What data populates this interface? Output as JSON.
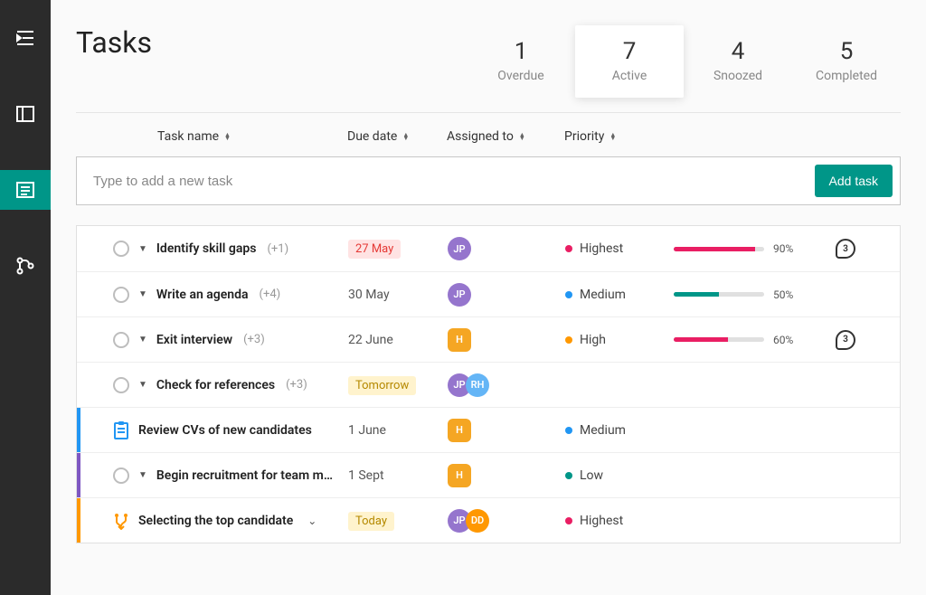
{
  "nav": [
    {
      "name": "indent-icon",
      "active": false
    },
    {
      "name": "panel-icon",
      "active": false
    },
    {
      "name": "list-icon",
      "active": true
    },
    {
      "name": "workflow-icon",
      "active": false
    }
  ],
  "page": {
    "title": "Tasks"
  },
  "summary": [
    {
      "count": "1",
      "label": "Overdue",
      "active": false
    },
    {
      "count": "7",
      "label": "Active",
      "active": true
    },
    {
      "count": "4",
      "label": "Snoozed",
      "active": false
    },
    {
      "count": "5",
      "label": "Completed",
      "active": false
    }
  ],
  "columns": {
    "task": "Task name",
    "due": "Due date",
    "assigned": "Assigned to",
    "priority": "Priority"
  },
  "input": {
    "placeholder": "Type to add a new task",
    "button": "Add task"
  },
  "tasks": [
    {
      "icon": "circle",
      "caret": true,
      "name": "Identify skill gaps",
      "sub": "(+1)",
      "due": "27 May",
      "dueStyle": "red",
      "assignees": [
        {
          "txt": "JP",
          "cls": "av-purple"
        }
      ],
      "priority": "Highest",
      "priorityClass": "dot-highest",
      "progress": 90,
      "progressClass": "pfill-pink",
      "progressText": "90%",
      "comments": "3",
      "bar": ""
    },
    {
      "icon": "circle",
      "caret": true,
      "name": "Write an agenda",
      "sub": "(+4)",
      "due": "30 May",
      "dueStyle": "plain",
      "assignees": [
        {
          "txt": "JP",
          "cls": "av-purple"
        }
      ],
      "priority": "Medium",
      "priorityClass": "dot-medium",
      "progress": 50,
      "progressClass": "pfill-teal",
      "progressText": "50%",
      "comments": "",
      "bar": ""
    },
    {
      "icon": "circle",
      "caret": true,
      "name": "Exit interview",
      "sub": "(+3)",
      "due": "22 June",
      "dueStyle": "plain",
      "assignees": [
        {
          "txt": "H",
          "cls": "av-gold"
        }
      ],
      "priority": "High",
      "priorityClass": "dot-high",
      "progress": 60,
      "progressClass": "pfill-pink",
      "progressText": "60%",
      "comments": "3",
      "bar": ""
    },
    {
      "icon": "circle",
      "caret": true,
      "name": "Check for references",
      "sub": "(+3)",
      "due": "Tomorrow",
      "dueStyle": "yellow",
      "assignees": [
        {
          "txt": "JP",
          "cls": "av-purple"
        },
        {
          "txt": "RH",
          "cls": "av-blue"
        }
      ],
      "priority": "",
      "priorityClass": "",
      "progress": null,
      "comments": "",
      "bar": ""
    },
    {
      "icon": "clipboard",
      "caret": false,
      "name": "Review CVs of new candidates",
      "sub": "",
      "due": "1 June",
      "dueStyle": "plain",
      "assignees": [
        {
          "txt": "H",
          "cls": "av-gold"
        }
      ],
      "priority": "Medium",
      "priorityClass": "dot-medium",
      "progress": null,
      "comments": "",
      "bar": "#2196f3"
    },
    {
      "icon": "circle",
      "caret": true,
      "name": "Begin recruitment for team manag...",
      "sub": "",
      "due": "1 Sept",
      "dueStyle": "plain",
      "assignees": [
        {
          "txt": "H",
          "cls": "av-gold"
        }
      ],
      "priority": "Low",
      "priorityClass": "dot-low",
      "progress": null,
      "comments": "",
      "bar": "#7e57c2"
    },
    {
      "icon": "branch",
      "caret": false,
      "dropdown": true,
      "name": "Selecting the top candidate",
      "sub": "",
      "due": "Today",
      "dueStyle": "yellow",
      "assignees": [
        {
          "txt": "JP",
          "cls": "av-purple"
        },
        {
          "txt": "DD",
          "cls": "av-orange"
        }
      ],
      "priority": "Highest",
      "priorityClass": "dot-highest",
      "progress": null,
      "comments": "",
      "bar": "#ff9800"
    }
  ]
}
